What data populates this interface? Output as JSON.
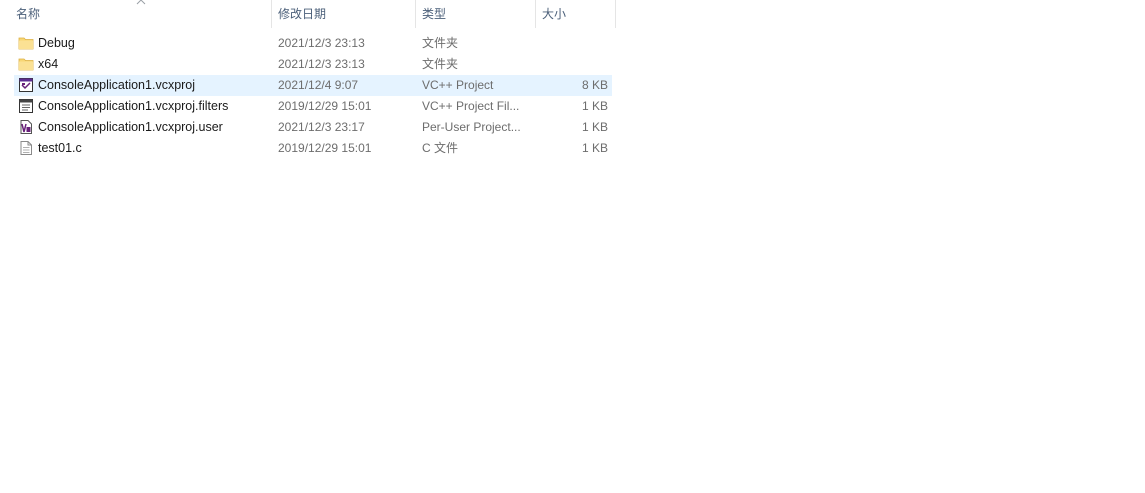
{
  "columns": {
    "name": "名称",
    "date": "修改日期",
    "type": "类型",
    "size": "大小"
  },
  "sort": {
    "column": "name",
    "direction": "ascending"
  },
  "files": [
    {
      "icon": "folder-icon",
      "name": "Debug",
      "date": "2021/12/3 23:13",
      "type": "文件夹",
      "size": ""
    },
    {
      "icon": "folder-icon",
      "name": "x64",
      "date": "2021/12/3 23:13",
      "type": "文件夹",
      "size": ""
    },
    {
      "icon": "vcxproj-icon",
      "name": "ConsoleApplication1.vcxproj",
      "date": "2021/12/4 9:07",
      "type": "VC++ Project",
      "size": "8 KB",
      "selected": true
    },
    {
      "icon": "filters-file-icon",
      "name": "ConsoleApplication1.vcxproj.filters",
      "date": "2019/12/29 15:01",
      "type": "VC++ Project Fil...",
      "size": "1 KB"
    },
    {
      "icon": "user-file-icon",
      "name": "ConsoleApplication1.vcxproj.user",
      "date": "2021/12/3 23:17",
      "type": "Per-User Project...",
      "size": "1 KB"
    },
    {
      "icon": "text-file-icon",
      "name": "test01.c",
      "date": "2019/12/29 15:01",
      "type": "C 文件",
      "size": "1 KB"
    }
  ],
  "colors": {
    "header_text": "#4c607a",
    "selection": "#e5f3ff",
    "folder": "#f8d775"
  }
}
